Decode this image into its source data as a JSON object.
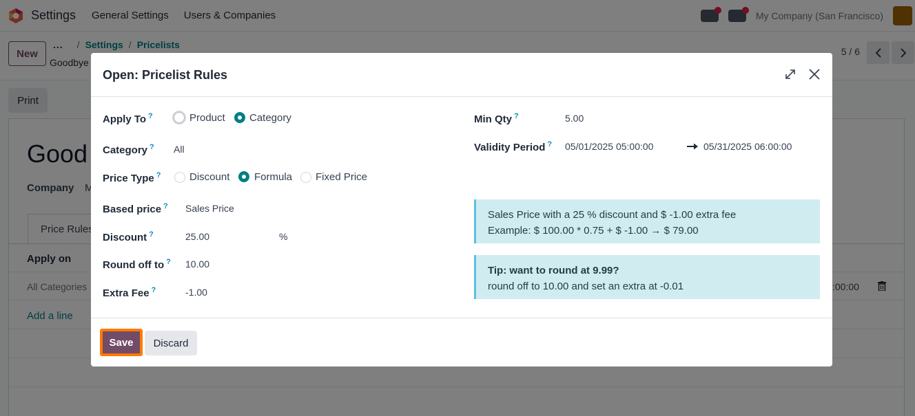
{
  "topbar": {
    "app_name": "Settings",
    "menu": [
      "General Settings",
      "Users & Companies"
    ],
    "company": "My Company (San Francisco)"
  },
  "controlbar": {
    "new_label": "New",
    "breadcrumb_more": "...",
    "breadcrumbs": [
      "Settings",
      "Pricelists"
    ],
    "record_name": "Goodbye",
    "pager": "5 / 6"
  },
  "background": {
    "print_label": "Print",
    "title": "Good",
    "company_label": "Company",
    "company_value": "M",
    "tab_label": "Price Rules",
    "col_apply_on": "Apply on",
    "row_category": "All Categories",
    "row_date_tail": ":00:00",
    "add_line": "Add a line"
  },
  "modal": {
    "title": "Open: Pricelist Rules",
    "help_mark": "?",
    "apply_to": {
      "label": "Apply To",
      "options": [
        "Product",
        "Category"
      ],
      "selected": "Category"
    },
    "category": {
      "label": "Category",
      "value": "All"
    },
    "price_type": {
      "label": "Price Type",
      "options": [
        "Discount",
        "Formula",
        "Fixed Price"
      ],
      "selected": "Formula"
    },
    "based_price": {
      "label": "Based price",
      "value": "Sales Price"
    },
    "discount": {
      "label": "Discount",
      "value": "25.00",
      "unit": "%"
    },
    "round_off": {
      "label": "Round off to",
      "value": "10.00"
    },
    "extra_fee": {
      "label": "Extra Fee",
      "value": "-1.00"
    },
    "min_qty": {
      "label": "Min Qty",
      "value": "5.00"
    },
    "validity": {
      "label": "Validity Period",
      "start": "05/01/2025 05:00:00",
      "end": "05/31/2025 06:00:00"
    },
    "info": {
      "line1": "Sales Price with a 25 % discount and $ -1.00 extra fee",
      "line2": "Example: $ 100.00 * 0.75 + $ -1.00 → $ 79.00"
    },
    "tip": {
      "title": "Tip: want to round at 9.99?",
      "text": "round off to 10.00 and set an extra at -0.01"
    },
    "save_label": "Save",
    "discard_label": "Discard"
  },
  "colors": {
    "primary": "#714b67",
    "link": "#017e84",
    "alert_bg": "#d1ecf1",
    "highlight": "#ff7a00"
  }
}
